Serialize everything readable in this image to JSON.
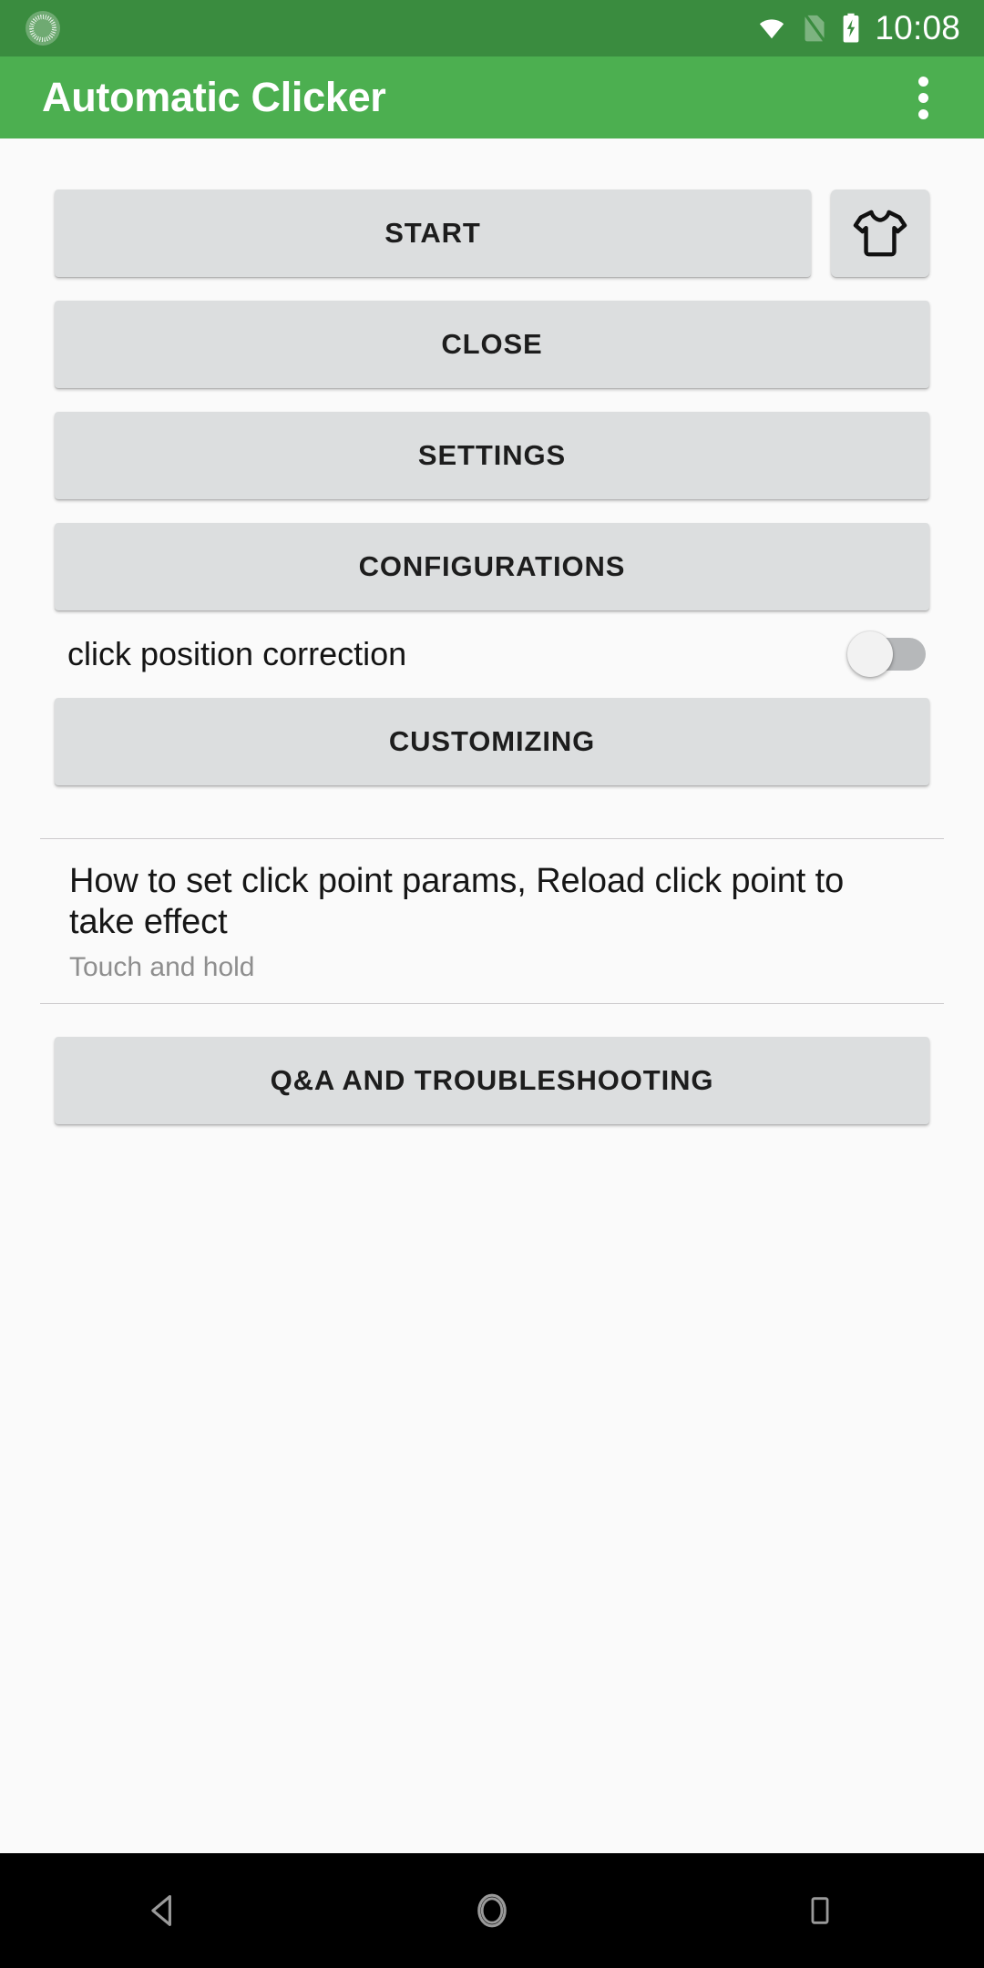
{
  "status_bar": {
    "time": "10:08",
    "icons": [
      "notification-circle-icon",
      "wifi-icon",
      "no-sim-icon",
      "battery-charging-icon"
    ],
    "background_color": "#3a8c3f"
  },
  "app_bar": {
    "title": "Automatic Clicker",
    "overflow_icon": "more-vert-icon",
    "background_color": "#4caf50",
    "title_color": "#ffffff"
  },
  "main": {
    "buttons": {
      "start": "START",
      "close": "CLOSE",
      "settings": "SETTINGS",
      "configurations": "CONFIGURATIONS",
      "customizing": "CUSTOMIZING",
      "qa_troubleshooting": "Q&A AND TROUBLESHOOTING"
    },
    "tshirt_button": {
      "icon": "tshirt-icon"
    },
    "toggle": {
      "label": "click position correction",
      "state": "off",
      "track_color": "#b6b8ba",
      "thumb_color": "#f2f2f2"
    },
    "info": {
      "title": "How to set click point params, Reload click point to take effect",
      "subtitle": "Touch and hold"
    },
    "button_color": "#dcdedf",
    "button_text_color": "#1d1d1d",
    "background_color": "#fafafa"
  },
  "nav_bar": {
    "items": [
      {
        "name": "back",
        "icon": "back-triangle-icon"
      },
      {
        "name": "home",
        "icon": "home-circle-icon"
      },
      {
        "name": "recents",
        "icon": "recents-square-icon"
      }
    ],
    "background_color": "#000000"
  }
}
